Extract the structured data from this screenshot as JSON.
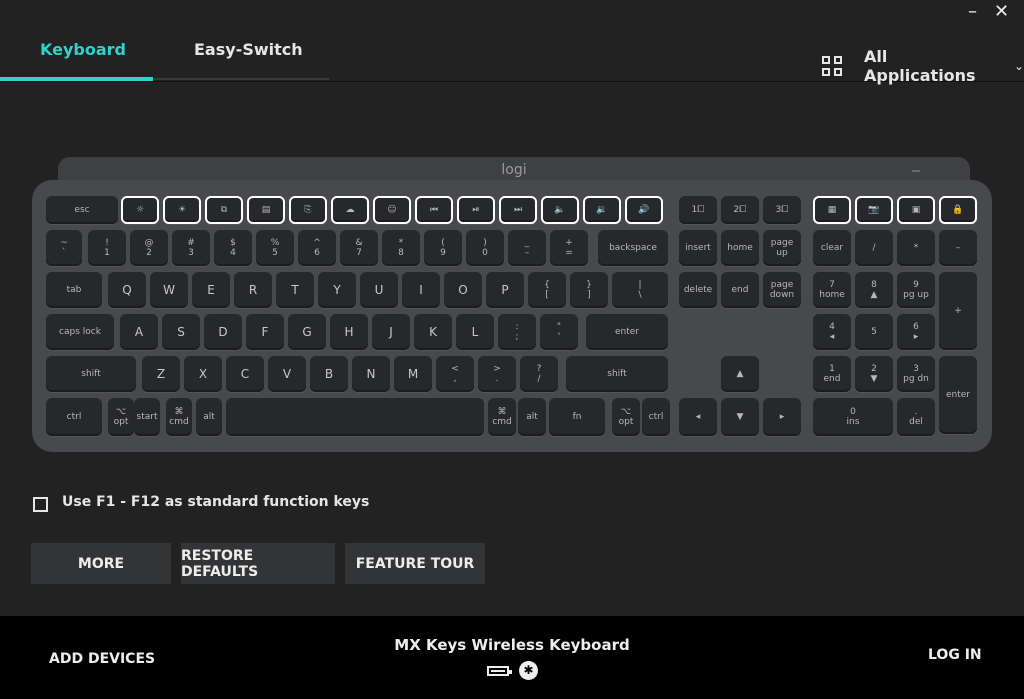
{
  "window": {
    "minimize": "–",
    "close": "✕"
  },
  "tabs": [
    {
      "label": "Keyboard"
    },
    {
      "label": "Easy-Switch"
    }
  ],
  "apps": {
    "label": "All Applications",
    "chevron": "⌄"
  },
  "keyboard": {
    "logo": "logi",
    "rows": [
      [
        {
          "t": "esc"
        },
        {
          "t": "☼"
        },
        {
          "t": "☀"
        },
        {
          "t": "⧉"
        },
        {
          "t": "▤"
        },
        {
          "t": "⎘"
        },
        {
          "t": "☁"
        },
        {
          "t": "☺"
        },
        {
          "t": "⏮"
        },
        {
          "t": "⏯"
        },
        {
          "t": "⏭"
        },
        {
          "t": "🔈"
        },
        {
          "t": "🔉"
        },
        {
          "t": "🔊"
        },
        {
          "t": "1⧠"
        },
        {
          "t": "2⧠"
        },
        {
          "t": "3⧠"
        },
        {
          "t": "▦"
        },
        {
          "t": "📷"
        },
        {
          "t": "▣"
        },
        {
          "t": "🔒"
        }
      ],
      [
        {
          "t": "~",
          "b": "`"
        },
        {
          "t": "!",
          "b": "1"
        },
        {
          "t": "@",
          "b": "2"
        },
        {
          "t": "#",
          "b": "3"
        },
        {
          "t": "$",
          "b": "4"
        },
        {
          "t": "%",
          "b": "5"
        },
        {
          "t": "^",
          "b": "6"
        },
        {
          "t": "&",
          "b": "7"
        },
        {
          "t": "*",
          "b": "8"
        },
        {
          "t": "(",
          "b": "9"
        },
        {
          "t": ")",
          "b": "0"
        },
        {
          "t": "_",
          "b": "–"
        },
        {
          "t": "+",
          "b": "="
        },
        {
          "t": "backspace"
        },
        {
          "t": "insert"
        },
        {
          "t": "home"
        },
        {
          "t": "page",
          "b": "up"
        },
        {
          "t": "clear"
        },
        {
          "t": "/"
        },
        {
          "t": "*"
        },
        {
          "t": "–"
        }
      ],
      [
        {
          "t": "tab"
        },
        {
          "t": "Q"
        },
        {
          "t": "W"
        },
        {
          "t": "E"
        },
        {
          "t": "R"
        },
        {
          "t": "T"
        },
        {
          "t": "Y"
        },
        {
          "t": "U"
        },
        {
          "t": "I"
        },
        {
          "t": "O"
        },
        {
          "t": "P"
        },
        {
          "t": "{",
          "b": "["
        },
        {
          "t": "}",
          "b": "]"
        },
        {
          "t": "|",
          "b": "\\"
        },
        {
          "t": "delete"
        },
        {
          "t": "end"
        },
        {
          "t": "page",
          "b": "down"
        },
        {
          "t": "7",
          "b": "home"
        },
        {
          "t": "8",
          "b": "▲"
        },
        {
          "t": "9",
          "b": "pg up"
        },
        {
          "t": "+"
        }
      ],
      [
        {
          "t": "caps lock"
        },
        {
          "t": "A"
        },
        {
          "t": "S"
        },
        {
          "t": "D"
        },
        {
          "t": "F"
        },
        {
          "t": "G"
        },
        {
          "t": "H"
        },
        {
          "t": "J"
        },
        {
          "t": "K"
        },
        {
          "t": "L"
        },
        {
          "t": ":",
          "b": ";"
        },
        {
          "t": "\"",
          "b": "'"
        },
        {
          "t": "enter"
        },
        {
          "t": "4",
          "b": "◂"
        },
        {
          "t": "5"
        },
        {
          "t": "6",
          "b": "▸"
        }
      ],
      [
        {
          "t": "shift"
        },
        {
          "t": "Z"
        },
        {
          "t": "X"
        },
        {
          "t": "C"
        },
        {
          "t": "V"
        },
        {
          "t": "B"
        },
        {
          "t": "N"
        },
        {
          "t": "M"
        },
        {
          "t": "<",
          "b": ","
        },
        {
          "t": ">",
          "b": "."
        },
        {
          "t": "?",
          "b": "/"
        },
        {
          "t": "shift"
        },
        {
          "t": "▲"
        },
        {
          "t": "1",
          "b": "end"
        },
        {
          "t": "2",
          "b": "▼"
        },
        {
          "t": "3",
          "b": "pg dn"
        },
        {
          "t": "enter"
        }
      ],
      [
        {
          "t": "ctrl"
        },
        {
          "t": "⌥",
          "b": "opt"
        },
        {
          "t": "start"
        },
        {
          "t": "⌘",
          "b": "cmd"
        },
        {
          "t": "alt"
        },
        {
          "t": ""
        },
        {
          "t": "⌘",
          "b": "cmd"
        },
        {
          "t": "alt"
        },
        {
          "t": "fn"
        },
        {
          "t": "⌥",
          "b": "opt"
        },
        {
          "t": "ctrl"
        },
        {
          "t": "◂"
        },
        {
          "t": "▼"
        },
        {
          "t": "▸"
        },
        {
          "t": "0",
          "b": "ins"
        },
        {
          "t": ".",
          "b": "del"
        },
        {
          "t": "="
        }
      ]
    ]
  },
  "option": {
    "label": "Use F1 - F12 as standard function keys",
    "checked": false
  },
  "buttons": {
    "more": "MORE",
    "restore": "RESTORE DEFAULTS",
    "tour": "FEATURE TOUR"
  },
  "footer": {
    "add_devices": "ADD DEVICES",
    "device_name": "MX Keys Wireless Keyboard",
    "bluetooth": "✱",
    "login": "LOG IN"
  },
  "colors": {
    "accent": "#2fd3c8",
    "background": "#222222",
    "footer": "#000000"
  }
}
